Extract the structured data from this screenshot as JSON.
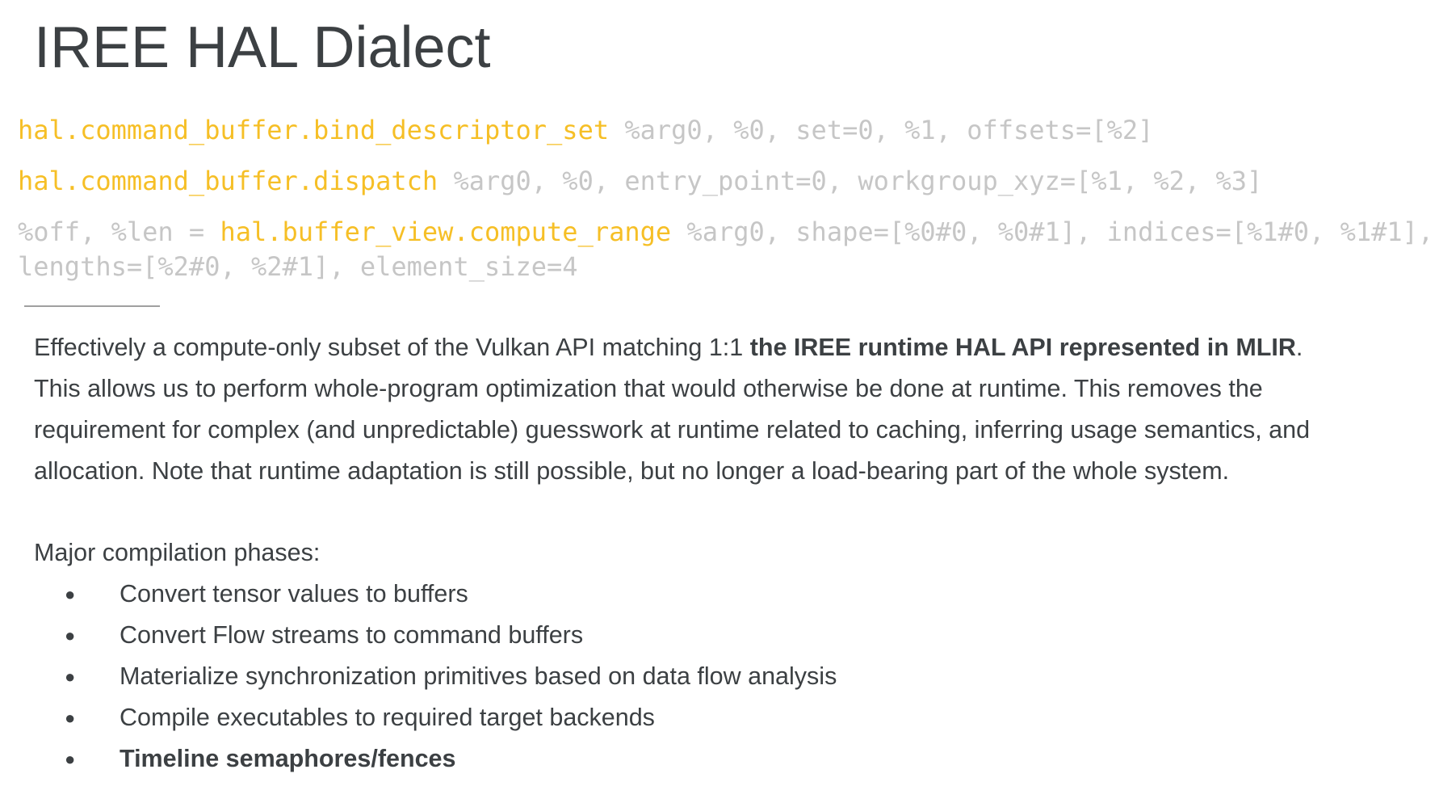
{
  "slide": {
    "title": "IREE HAL Dialect",
    "code": {
      "line1": {
        "op": "hal.command_buffer.bind_descriptor_set",
        "args": " %arg0, %0, set=0, %1, offsets=[%2]"
      },
      "line2": {
        "op": "hal.command_buffer.dispatch",
        "args": " %arg0, %0, entry_point=0, workgroup_xyz=[%1, %2, %3]"
      },
      "line3": {
        "prefix": "%off, %len = ",
        "op": "hal.buffer_view.compute_range",
        "args": " %arg0, shape=[%0#0, %0#1], indices=[%1#0, %1#1],"
      },
      "line4": {
        "args": "lengths=[%2#0, %2#1], element_size=4"
      }
    },
    "description": {
      "line1_start": "Effectively a compute-only subset of the Vulkan API matching 1:1 ",
      "line1_bold": "the IREE runtime HAL API represented in MLIR",
      "line1_end": ".",
      "line2": "This allows us to perform whole-program optimization that would otherwise be done at runtime. This removes the",
      "line3": "requirement for complex (and unpredictable) guesswork at runtime related to caching, inferring usage semantics, and",
      "line4": "allocation. Note that runtime adaptation is still possible, but no longer a load-bearing part of the whole system."
    },
    "phases": {
      "label": "Major compilation phases:",
      "bullet_glyph": "●",
      "items": [
        "Convert tensor values to buffers",
        "Convert Flow streams to command buffers",
        "Materialize synchronization primitives based on data flow analysis",
        "Compile executables to required target backends",
        "Timeline semaphores/fences"
      ]
    },
    "colors": {
      "op_highlight": "#f6bf26",
      "code_muted": "#c6c6c6",
      "text": "#3c4043"
    }
  }
}
